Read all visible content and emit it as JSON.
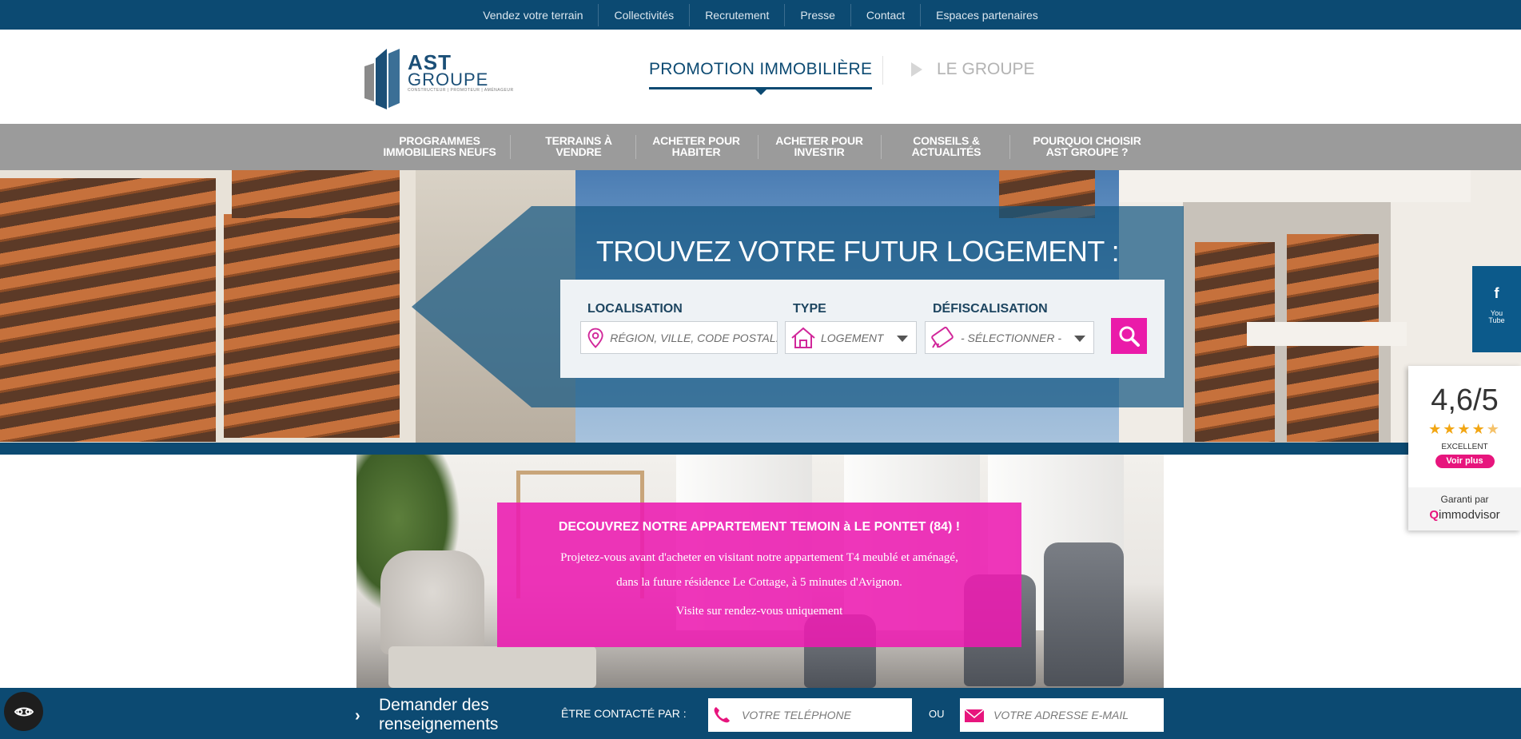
{
  "topbar": {
    "links": [
      "Vendez votre terrain",
      "Collectivités",
      "Recrutement",
      "Presse",
      "Contact",
      "Espaces partenaires"
    ]
  },
  "header": {
    "logo": {
      "line1": "AST",
      "line2": "GROUPE",
      "tagline": "CONSTRUCTEUR | PROMOTEUR | AMÉNAGEUR"
    },
    "tab_active": "PROMOTION IMMOBILIÈRE",
    "tab_other": "LE GROUPE"
  },
  "mainnav": {
    "items": [
      {
        "line1": "PROGRAMMES",
        "line2": "IMMOBILIERS NEUFS"
      },
      {
        "line1": "TERRAINS À",
        "line2": "VENDRE"
      },
      {
        "line1": "ACHETER POUR",
        "line2": "HABITER"
      },
      {
        "line1": "ACHETER POUR",
        "line2": "INVESTIR"
      },
      {
        "line1": "CONSEILS &",
        "line2": "ACTUALITÉS"
      },
      {
        "line1": "POURQUOI CHOISIR",
        "line2": "AST GROUPE ?"
      }
    ]
  },
  "hero": {
    "title": "TROUVEZ VOTRE FUTUR LOGEMENT :",
    "search": {
      "localisation_label": "LOCALISATION",
      "localisation_placeholder": "RÉGION, VILLE, CODE POSTAL...",
      "type_label": "TYPE",
      "type_value": "LOGEMENT",
      "defisc_label": "DÉFISCALISATION",
      "defisc_value": "- SÉLECTIONNER -"
    }
  },
  "social": {
    "facebook": "f",
    "youtube_line1": "You",
    "youtube_line2": "Tube"
  },
  "rating": {
    "score": "4,6/5",
    "stars": 4.6,
    "label": "EXCELLENT",
    "button": "Voir plus",
    "guarantee": "Garanti par",
    "provider_prefix": "Q",
    "provider": "immodvisor"
  },
  "promo": {
    "title": "DECOUVREZ NOTRE APPARTEMENT TEMOIN à LE PONTET (84) !",
    "text_line1": "Projetez-vous avant d'acheter en visitant notre appartement T4 meublé et aménagé,",
    "text_line2": "dans la future résidence Le Cottage, à 5 minutes d'Avignon.",
    "note": "Visite sur rendez-vous uniquement"
  },
  "contactbar": {
    "title_line1": "Demander des",
    "title_line2": "renseignements",
    "contact_by": "ÊTRE CONTACTÉ PAR :",
    "phone_placeholder": "VOTRE TELÉPHONE",
    "or": "OU",
    "email_placeholder": "VOTRE ADRESSE E-MAIL"
  },
  "colors": {
    "primary": "#0c4a72",
    "magenta": "#ea1ba9",
    "nav_grey": "#9b9b9b",
    "star": "#f2a614"
  }
}
